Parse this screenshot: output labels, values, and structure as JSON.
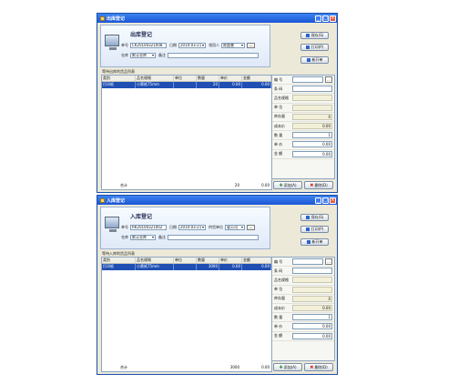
{
  "out": {
    "title": "出库登记",
    "header_title": "出库登记",
    "fields": {
      "no_label": "单号",
      "no_value": "CK20100321008",
      "date_label": "日期",
      "date_value": "2010-03-21",
      "person_label": "领用人",
      "person_value": "陈超慧",
      "warehouse_label": "仓库",
      "warehouse_value": "默认仓库",
      "remark_label": "备注",
      "remark_value": "",
      "dots": "..."
    },
    "buttons": {
      "save": "保存(S)",
      "print": "打印(P)",
      "new": "新开单"
    },
    "list_caption": "等待出库的货品列表",
    "columns": [
      "类别",
      "品名规格",
      "单位",
      "数量",
      "单价",
      "金额"
    ],
    "rows": [
      [
        "打印纸",
        "小票纸75mm",
        "",
        "20",
        "0.00",
        "0.00"
      ]
    ],
    "footer": {
      "label": "合计",
      "qty": "20",
      "amount": "0.00"
    },
    "panel": [
      {
        "label": "编 号",
        "value": ""
      },
      {
        "label": "条 码",
        "value": ""
      },
      {
        "label": "品名规格",
        "value": ""
      },
      {
        "label": "单 位",
        "value": ""
      },
      {
        "label": "库存量",
        "value": "0"
      },
      {
        "label": "成本价",
        "value": "0.00"
      },
      {
        "label": "数 量",
        "value": "1"
      },
      {
        "label": "单 价",
        "value": "0.00"
      },
      {
        "label": "金 额",
        "value": "0.00"
      }
    ],
    "panel_buttons": {
      "add": "添加(A)",
      "delete": "删除(D)"
    }
  },
  "in": {
    "title": "入库登记",
    "header_title": "入库登记",
    "fields": {
      "no_label": "单号",
      "no_value": "RK20100321002",
      "date_label": "日期",
      "date_value": "2010-03-21",
      "person_label": "供货单位",
      "person_value": "省公司",
      "warehouse_label": "仓库",
      "warehouse_value": "默认仓库",
      "remark_label": "备注",
      "remark_value": "",
      "dots": "..."
    },
    "buttons": {
      "save": "保存(S)",
      "print": "打印(P)",
      "new": "新开单"
    },
    "list_caption": "等待入库的货品列表",
    "columns": [
      "类别",
      "品名规格",
      "单位",
      "数量",
      "单价",
      "金额"
    ],
    "rows": [
      [
        "打印纸",
        "小票纸75mm",
        "",
        "3000",
        "0.00",
        "0.00"
      ]
    ],
    "footer": {
      "label": "合计",
      "qty": "3000",
      "amount": "0.00"
    },
    "panel": [
      {
        "label": "编 号",
        "value": ""
      },
      {
        "label": "条 码",
        "value": ""
      },
      {
        "label": "品名规格",
        "value": ""
      },
      {
        "label": "单 位",
        "value": ""
      },
      {
        "label": "库存量",
        "value": "0"
      },
      {
        "label": "成本价",
        "value": "0.00"
      },
      {
        "label": "数 量",
        "value": "1"
      },
      {
        "label": "单 价",
        "value": "0.00"
      },
      {
        "label": "金 额",
        "value": "0.00"
      }
    ],
    "panel_buttons": {
      "add": "添加(A)",
      "delete": "删除(D)"
    }
  }
}
